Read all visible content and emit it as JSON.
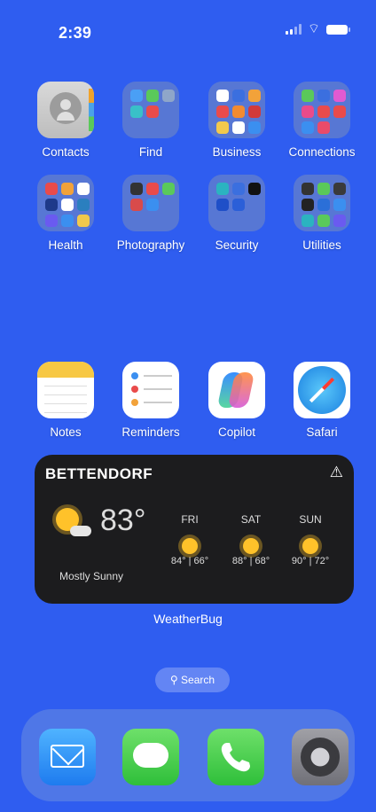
{
  "status_bar": {
    "time": "2:39"
  },
  "apps_row1": [
    {
      "label": "Contacts"
    },
    {
      "label": "Find"
    },
    {
      "label": "Business"
    },
    {
      "label": "Connections"
    }
  ],
  "apps_row2": [
    {
      "label": "Health"
    },
    {
      "label": "Photography"
    },
    {
      "label": "Security"
    },
    {
      "label": "Utilities"
    }
  ],
  "apps_row3": [
    {
      "label": "Notes"
    },
    {
      "label": "Reminders"
    },
    {
      "label": "Copilot"
    },
    {
      "label": "Safari"
    }
  ],
  "weather": {
    "city": "BETTENDORF",
    "warning": "⚠",
    "current_temp": "83°",
    "condition": "Mostly Sunny",
    "forecast": [
      {
        "day": "FRI",
        "hilo": "84° | 66°"
      },
      {
        "day": "SAT",
        "hilo": "88° | 68°"
      },
      {
        "day": "SUN",
        "hilo": "90° | 72°"
      }
    ],
    "source_label": "WeatherBug"
  },
  "search": {
    "label": "Search"
  },
  "dock": [
    "mail",
    "messages",
    "phone",
    "settings"
  ],
  "colors": {
    "wallpaper": "#2f5df0",
    "widget_bg": "#1c1c1e",
    "sun": "#ffc22a"
  }
}
